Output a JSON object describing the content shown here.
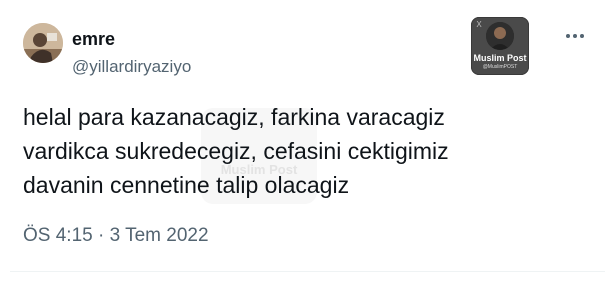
{
  "tweet": {
    "author": {
      "display_name": "emre",
      "handle": "@yillardiryaziyo"
    },
    "text_lines": [
      "helal para kazanacagiz, farkina varacagiz",
      "vardikca sukredecegiz, cefasini cektigimiz",
      "davanin cennetine talip olacagiz"
    ],
    "timestamp": "ÖS 4:15 · 3 Tem 2022",
    "more_icon": "more-horizontal-icon"
  },
  "badge": {
    "title": "Muslim Post",
    "handle": "@MuslimPOST",
    "mark": "X"
  },
  "watermark": {
    "text": "Muslim Post"
  },
  "colors": {
    "text_primary": "#0f1419",
    "text_secondary": "#536471",
    "divider": "#eff3f4",
    "badge_bg": "#4a4a4a"
  }
}
